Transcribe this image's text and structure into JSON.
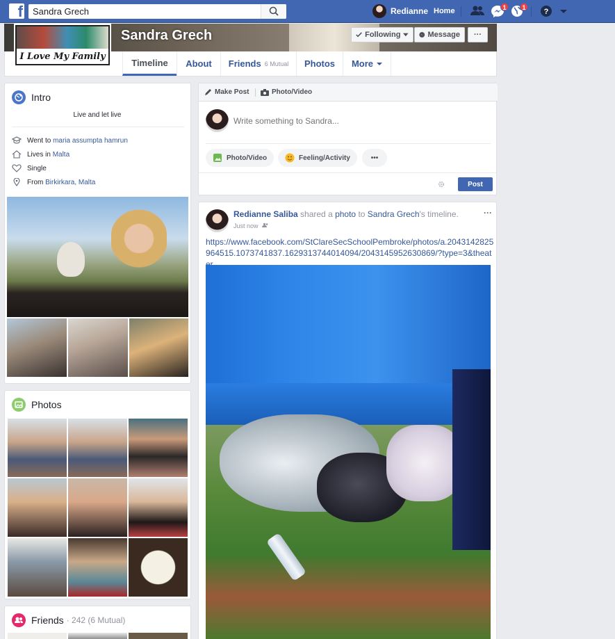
{
  "topbar": {
    "search_value": "Sandra Grech",
    "user_name": "Redianne",
    "home_label": "Home",
    "messages_badge": "1",
    "notifications_badge": "1"
  },
  "profile": {
    "name": "Sandra Grech",
    "picture_caption": "I Love My Family",
    "following_label": "Following",
    "message_label": "Message",
    "more_dots": "···"
  },
  "nav": {
    "timeline": "Timeline",
    "about": "About",
    "friends": "Friends",
    "friends_mutual": "6 Mutual",
    "photos": "Photos",
    "more": "More"
  },
  "intro": {
    "title": "Intro",
    "bio": "Live and let live",
    "went_to_prefix": "Went to",
    "went_to_link": "maria assumpta hamrun",
    "lives_prefix": "Lives in",
    "lives_link": "Malta",
    "relationship": "Single",
    "from_prefix": "From",
    "from_link": "Birkirkara, Malta"
  },
  "photos_card": {
    "title": "Photos"
  },
  "friends_card": {
    "title": "Friends",
    "count": "· 242 (6 Mutual)"
  },
  "composer": {
    "make_post": "Make Post",
    "photo_video_tab": "Photo/Video",
    "placeholder": "Write something to Sandra...",
    "photo_video_btn": "Photo/Video",
    "feeling_btn": "Feeling/Activity",
    "more_btn": "•••",
    "post_btn": "Post"
  },
  "post": {
    "author": "Redianne Saliba",
    "shared_text": " shared a ",
    "photo_word": "photo",
    "to_word": " to ",
    "target": "Sandra Grech",
    "target_suffix": "'s timeline.",
    "time": "Just now",
    "options": "···",
    "url": "https://www.facebook.com/StClareSecSchoolPembroke/photos/a.2043142825964515.1073741837.1629313744014094/2043145952630869/?type=3&theater"
  },
  "colors": {
    "brand_blue": "#4267b2",
    "link_blue": "#365899",
    "badge_red": "#fa3e3e",
    "page_bg": "#e9ebee"
  }
}
